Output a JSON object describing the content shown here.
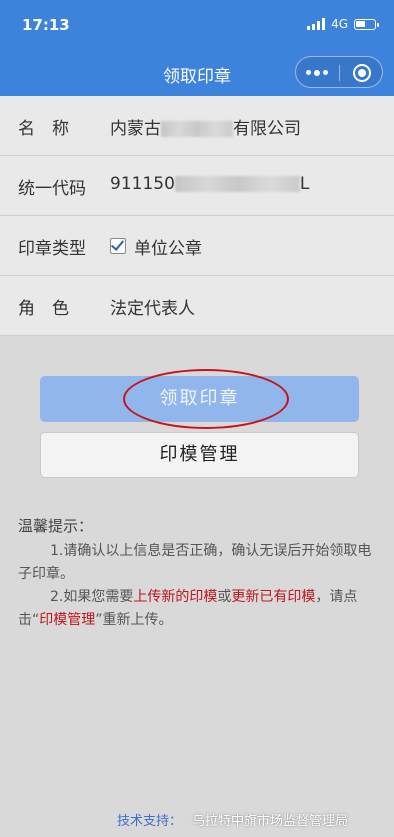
{
  "status": {
    "time": "17:13",
    "network": "4G"
  },
  "nav": {
    "title": "领取印章"
  },
  "form": {
    "name": {
      "label": "名　称",
      "value_prefix": "内蒙古",
      "value_suffix": "有限公司"
    },
    "code": {
      "label": "统一代码",
      "value_prefix": "911150",
      "value_suffix": "L"
    },
    "seal_type": {
      "label": "印章类型",
      "option": "单位公章",
      "checked": true
    },
    "role": {
      "label": "角　色",
      "value": "法定代表人"
    }
  },
  "buttons": {
    "receive": "领取印章",
    "manage": "印模管理"
  },
  "tips": {
    "title": "温馨提示：",
    "tip1": "1.请确认以上信息是否正确，确认无误后开始领取电子印章。",
    "tip2_a": "2.如果您需要",
    "tip2_upload": "上传新的印模",
    "tip2_or": "或",
    "tip2_update": "更新已有印模",
    "tip2_b": "，请点击“",
    "tip2_manage": "印模管理",
    "tip2_c": "”重新上传。"
  },
  "footer": {
    "label": "技术支持：",
    "value": "乌拉特中旗市场监督管理局"
  },
  "colors": {
    "primary": "#3d82db",
    "button": "#91b6ec",
    "highlight": "#c0151b"
  }
}
